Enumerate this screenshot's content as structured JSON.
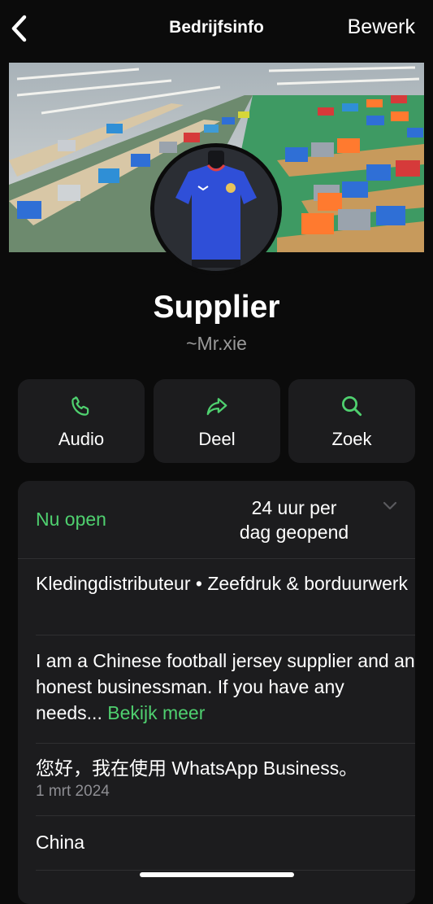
{
  "header": {
    "title": "Bedrijfsinfo",
    "edit_label": "Bewerk"
  },
  "profile": {
    "name": "Supplier",
    "handle": "~Mr.xie"
  },
  "actions": [
    {
      "label": "Audio",
      "icon": "phone-icon"
    },
    {
      "label": "Deel",
      "icon": "share-arrow-icon"
    },
    {
      "label": "Zoek",
      "icon": "search-icon"
    }
  ],
  "info": {
    "status": "Nu open",
    "hours_line1": "24 uur per",
    "hours_line2": "dag geopend",
    "category": "Kledingdistributeur • Zeefdruk & borduurwerk",
    "description": "I am a Chinese football jersey supplier and an honest businessman. If you have any needs...",
    "read_more": "Bekijk meer",
    "about": "您好，我在使用 WhatsApp Business。",
    "about_date": "1 mrt 2024",
    "country": "China"
  },
  "colors": {
    "accent": "#4fd06f",
    "background": "#0b0b0b",
    "card": "#1c1c1e"
  }
}
